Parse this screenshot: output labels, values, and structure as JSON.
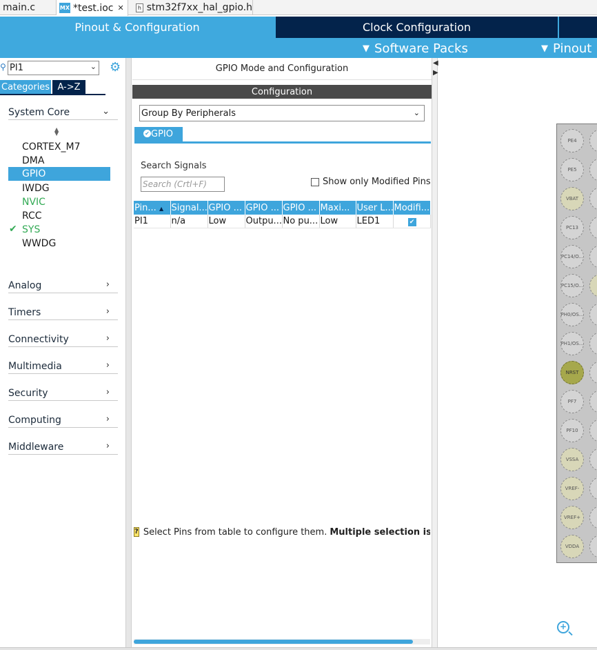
{
  "editor_tabs": [
    {
      "label": "main.c"
    },
    {
      "label": "*test.ioc",
      "icon": "MX",
      "close": "✕"
    },
    {
      "label": "stm32f7xx_hal_gpio.h",
      "icon": "h"
    }
  ],
  "banner": {
    "tabs": {
      "pinout": "Pinout & Configuration",
      "clock": "Clock Configuration"
    },
    "menus": {
      "software_packs": "Software Packs",
      "pinout": "Pinout"
    }
  },
  "left": {
    "search_value": "PI1",
    "view_tabs": {
      "categories": "Categories",
      "az": "A->Z"
    },
    "system_core": {
      "label": "System Core",
      "items": [
        {
          "label": "CORTEX_M7"
        },
        {
          "label": "DMA"
        },
        {
          "label": "GPIO"
        },
        {
          "label": "IWDG"
        },
        {
          "label": "NVIC"
        },
        {
          "label": "RCC"
        },
        {
          "label": "SYS"
        },
        {
          "label": "WWDG"
        }
      ]
    },
    "categories": [
      {
        "label": "Analog"
      },
      {
        "label": "Timers"
      },
      {
        "label": "Connectivity"
      },
      {
        "label": "Multimedia"
      },
      {
        "label": "Security"
      },
      {
        "label": "Computing"
      },
      {
        "label": "Middleware"
      }
    ]
  },
  "mid": {
    "title": "GPIO Mode and Configuration",
    "config_bar": "Configuration",
    "group_by": "Group By Peripherals",
    "tab_gpio": "GPIO",
    "search_signals_label": "Search Signals",
    "search_signals_placeholder": "Search (Crtl+F)",
    "show_modified_label": "Show only Modified Pins",
    "table": {
      "headers": [
        "Pin...",
        "Signal...",
        "GPIO ...",
        "GPIO ...",
        "GPIO ...",
        "Maxi...",
        "User L...",
        "Modifi..."
      ],
      "rows": [
        {
          "pin": "PI1",
          "signal": "n/a",
          "output_level": "Low",
          "mode": "Outpu...",
          "pull": "No pu...",
          "max_speed": "Low",
          "user_label": "LED1",
          "modified": true
        }
      ]
    },
    "hint_text": "Select Pins from table to configure them.",
    "hint_bold": "Multiple selection is Allowed",
    "hint_icon": "?"
  },
  "pinout": {
    "pins": [
      "PE4",
      "PE5",
      "VBAT",
      "PC13",
      "PC14/O...",
      "PC15/O...",
      "PH0/OS...",
      "PH1/OS...",
      "NRST",
      "PF7",
      "PF10",
      "VSSA",
      "VREF-",
      "VREF+",
      "VDDA"
    ]
  },
  "colors": {
    "accent": "#3ea5dc",
    "navy": "#03234b",
    "banner": "#3fa9de",
    "green": "#33aa55"
  }
}
